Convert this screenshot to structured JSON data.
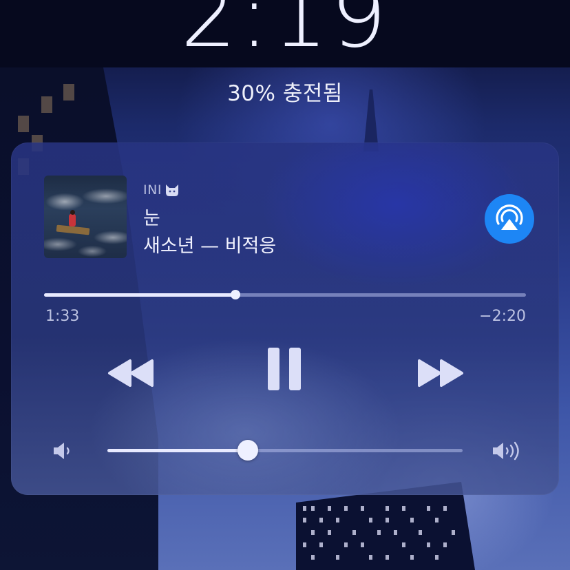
{
  "lockscreen": {
    "time": "2:19",
    "charging_status": "30% 충전됨"
  },
  "now_playing": {
    "source_app": "INI",
    "source_icon": "cat-icon",
    "song_title": "눈",
    "song_subtitle": "새소년 — 비적응",
    "album_art_icon": "album-art-raft-at-sea",
    "airplay_icon": "airplay-icon",
    "airplay_color": "#1d86f5"
  },
  "playback": {
    "elapsed": "1:33",
    "remaining": "−2:20",
    "progress_fraction": 0.397
  },
  "controls": {
    "rewind_icon": "rewind-icon",
    "pause_icon": "pause-icon",
    "fast_forward_icon": "fast-forward-icon"
  },
  "volume": {
    "level_fraction": 0.395,
    "low_icon": "speaker-low-icon",
    "high_icon": "speaker-high-icon"
  }
}
